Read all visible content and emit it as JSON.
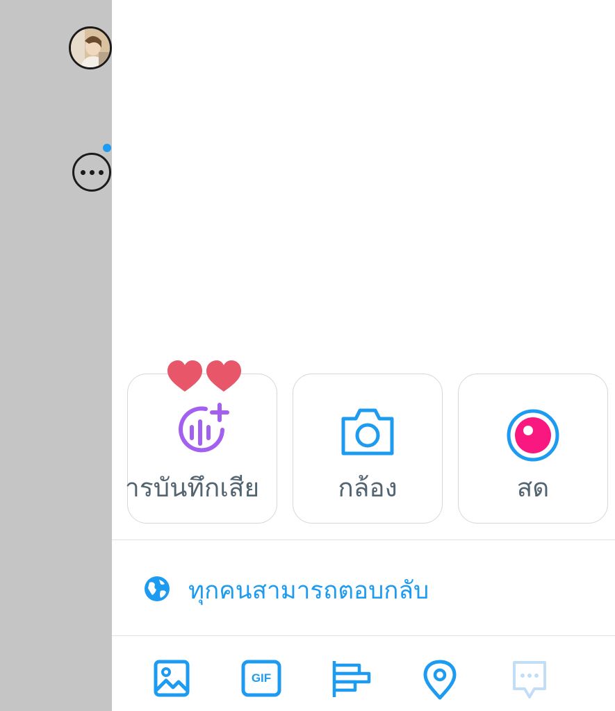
{
  "composer": {
    "media_options": [
      {
        "name": "voice-record",
        "label": "ารบันทึกเสีย",
        "icon": "voice-plus-icon",
        "color": "#a35ff0"
      },
      {
        "name": "camera",
        "label": "กล้อง",
        "icon": "camera-icon",
        "color": "#1d9bf0"
      },
      {
        "name": "live",
        "label": "สด",
        "icon": "live-icon",
        "color": "#f91880"
      }
    ],
    "reply_setting": {
      "label": "ทุกคนสามารถตอบกลับ",
      "icon": "globe-icon"
    },
    "toolbar": [
      {
        "name": "image",
        "icon": "image-icon"
      },
      {
        "name": "gif",
        "icon": "gif-icon",
        "text": "GIF"
      },
      {
        "name": "poll",
        "icon": "poll-icon"
      },
      {
        "name": "location",
        "icon": "location-pin-icon"
      },
      {
        "name": "thread",
        "icon": "chat-dots-icon",
        "disabled": true
      }
    ]
  },
  "colors": {
    "accent": "#1d9bf0",
    "voice": "#a35ff0",
    "live": "#f91880",
    "heart": "#e8566a",
    "dim_overlay": "#c4c5c4"
  }
}
